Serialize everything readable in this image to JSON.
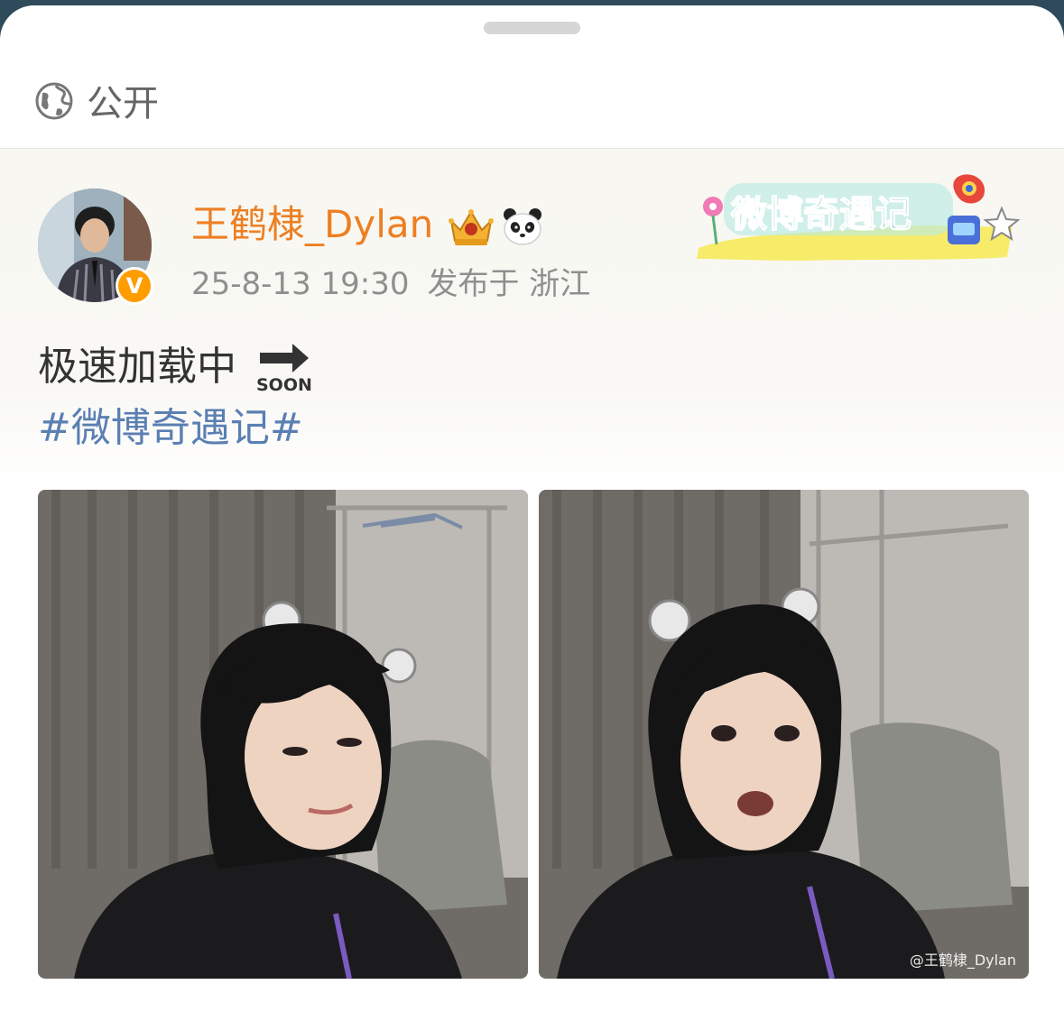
{
  "visibility": {
    "label": "公开",
    "icon": "globe-icon"
  },
  "post": {
    "author": {
      "name": "王鹤棣_Dylan",
      "verified": true,
      "badge_letter": "V",
      "badges": [
        "crown-icon",
        "panda-icon"
      ]
    },
    "timestamp": "25-8-13 19:30",
    "location": "发布于 浙江",
    "event_sticker": {
      "text": "微博奇遇记"
    },
    "text": "极速加载中",
    "emoji": {
      "icon": "soon-arrow-icon",
      "text": "SOON"
    },
    "hashtag": "#微博奇遇记#",
    "photos": [
      {
        "description": "selfie-1"
      },
      {
        "description": "selfie-2",
        "watermark": "@王鹤棣_Dylan"
      }
    ]
  },
  "colors": {
    "author_name": "#ee7f22",
    "hashtag": "#5a7fb3",
    "meta": "#8f8f8f",
    "badge": "#ff9d00"
  }
}
